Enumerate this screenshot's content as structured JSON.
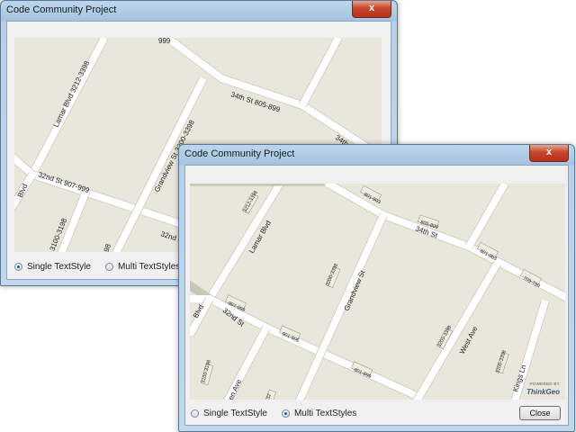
{
  "back_window": {
    "title": "Code Community Project",
    "close_glyph": "x",
    "labels": {
      "lamar": "Lamar Blvd 3212-3398",
      "top_left": "999",
      "st34_a": "34th St 805-899",
      "st34_b": "34th St 709-799",
      "grandview": "Grandview St 3200-3398",
      "st32": "32nd St 907-999",
      "st32_b": "32nd St",
      "blvd": "Blvd",
      "owen": "Ave 3100-3198",
      "third": "00-3198"
    },
    "options": {
      "single": "Single TextStyle",
      "multi": "Multi TextStyles",
      "selected": "single"
    }
  },
  "front_window": {
    "title": "Code Community Project",
    "close_glyph": "x",
    "labels": {
      "lamar": "Lamar Blvd",
      "lamar_range": "3212-3398",
      "st34": "34th St",
      "r801_top": "801-803",
      "r805": "805-899",
      "r801_right": "801-803",
      "r709": "709-799",
      "grandview": "Grandview St",
      "grandview_range": "3200-3398",
      "west": "West Ave",
      "west_range": "3200-3398",
      "kings": "Kings Ln",
      "kings_range": "3200-3398",
      "blvd": "Blvd",
      "st32": "32nd St",
      "r907": "907-999",
      "r901": "901-905",
      "r801_low": "801-899",
      "owen": "Owen Ave",
      "owen_range": "3100-3198",
      "r32": "32"
    },
    "brand_powered": "POWERED BY",
    "brand_name": "ThinkGeo",
    "options": {
      "single": "Single TextStyle",
      "multi": "Multi TextStyles",
      "selected": "multi"
    },
    "close_button": "Close"
  }
}
